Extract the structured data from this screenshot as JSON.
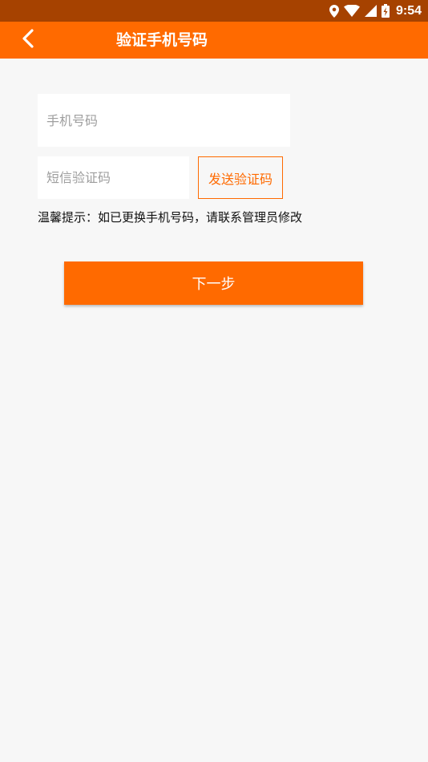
{
  "status_bar": {
    "time": "9:54",
    "icons": [
      "location-icon",
      "wifi-icon",
      "signal-icon",
      "battery-icon"
    ],
    "background": "#a64200"
  },
  "app_bar": {
    "title": "验证手机号码",
    "back_icon": "chevron-left-icon",
    "background": "#ff6a00"
  },
  "form": {
    "phone_placeholder": "手机号码",
    "phone_value": "",
    "code_placeholder": "短信验证码",
    "code_value": "",
    "send_code_label": "发送验证码",
    "hint": "温馨提示：如已更换手机号码，请联系管理员修改",
    "next_label": "下一步"
  },
  "colors": {
    "accent": "#ff6a00",
    "page_background": "#f7f7f7"
  }
}
